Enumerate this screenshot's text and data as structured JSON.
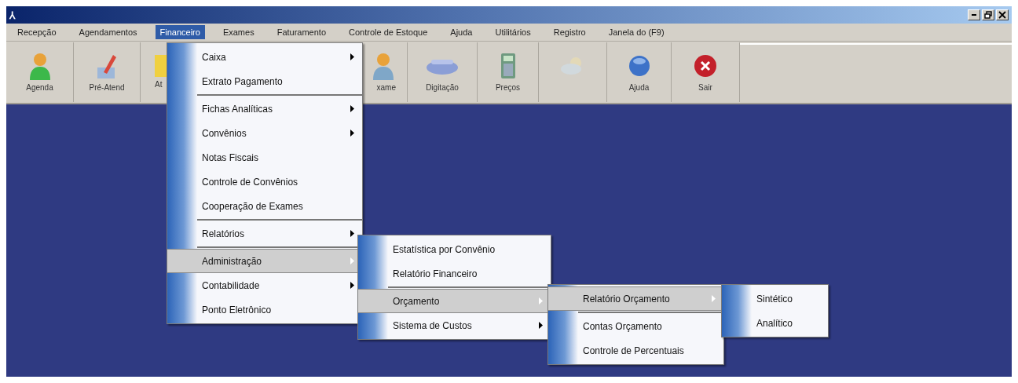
{
  "window": {
    "title_icon": "⅄"
  },
  "menu_bar": [
    {
      "label": "Recepção",
      "selected": false
    },
    {
      "label": "Agendamentos",
      "selected": false
    },
    {
      "label": "Financeiro",
      "selected": true
    },
    {
      "label": "Exames",
      "selected": false
    },
    {
      "label": "Faturamento",
      "selected": false
    },
    {
      "label": "Controle de Estoque",
      "selected": false
    },
    {
      "label": "Ajuda",
      "selected": false
    },
    {
      "label": "Utilitários",
      "selected": false
    },
    {
      "label": "Registro",
      "selected": false
    },
    {
      "label": "Janela do (F9)",
      "selected": false
    }
  ],
  "toolbar": [
    {
      "label": "Agenda",
      "kind": "person",
      "disabled": false
    },
    {
      "label": "Pré-Atend",
      "kind": "pencil",
      "disabled": false
    },
    {
      "label": "At",
      "kind": "note",
      "disabled": false
    },
    {
      "label": "xame",
      "kind": "person2",
      "disabled": false
    },
    {
      "label": "Digitação",
      "kind": "scanner",
      "disabled": false
    },
    {
      "label": "Preços",
      "kind": "calculator",
      "disabled": false
    },
    {
      "kind": "cloud",
      "disabled": true
    },
    {
      "label": "Ajuda",
      "kind": "globe",
      "disabled": false
    },
    {
      "label": "Sair",
      "kind": "exit",
      "disabled": false
    }
  ],
  "menus": [
    {
      "items": [
        {
          "kind": "item",
          "label": "Caixa",
          "submenu": true,
          "selected": false
        },
        {
          "kind": "item",
          "label": "Extrato Pagamento",
          "submenu": false,
          "selected": false
        },
        {
          "kind": "separator"
        },
        {
          "kind": "item",
          "label": "Fichas Analíticas",
          "submenu": true,
          "selected": false
        },
        {
          "kind": "item",
          "label": "Convênios",
          "submenu": true,
          "selected": false
        },
        {
          "kind": "item",
          "label": "Notas Fiscais",
          "submenu": false,
          "selected": false
        },
        {
          "kind": "item",
          "label": "Controle de Convênios",
          "submenu": false,
          "selected": false
        },
        {
          "kind": "item",
          "label": "Cooperação de Exames",
          "submenu": false,
          "selected": false
        },
        {
          "kind": "separator"
        },
        {
          "kind": "item",
          "label": "Relatórios",
          "submenu": true,
          "selected": false
        },
        {
          "kind": "separator"
        },
        {
          "kind": "item",
          "label": "Administração",
          "submenu": true,
          "selected": true
        },
        {
          "kind": "item",
          "label": "Contabilidade",
          "submenu": true,
          "selected": false
        },
        {
          "kind": "item",
          "label": "Ponto Eletrônico",
          "submenu": false,
          "selected": false
        }
      ]
    },
    {
      "items": [
        {
          "kind": "item",
          "label": "Estatística por Convênio",
          "submenu": false,
          "selected": false
        },
        {
          "kind": "item",
          "label": "Relatório Financeiro",
          "submenu": false,
          "selected": false
        },
        {
          "kind": "separator"
        },
        {
          "kind": "item",
          "label": "Orçamento",
          "submenu": true,
          "selected": true
        },
        {
          "kind": "item",
          "label": "Sistema de Custos",
          "submenu": true,
          "selected": false
        }
      ]
    },
    {
      "items": [
        {
          "kind": "item",
          "label": "Relatório Orçamento",
          "submenu": true,
          "selected": true
        },
        {
          "kind": "separator"
        },
        {
          "kind": "item",
          "label": "Contas Orçamento",
          "submenu": false,
          "selected": false
        },
        {
          "kind": "item",
          "label": "Controle de Percentuais",
          "submenu": false,
          "selected": false
        }
      ]
    },
    {
      "items": [
        {
          "kind": "item",
          "label": "Sintético",
          "submenu": false,
          "selected": false
        },
        {
          "kind": "item",
          "label": "Analítico",
          "submenu": false,
          "selected": false
        }
      ]
    }
  ]
}
